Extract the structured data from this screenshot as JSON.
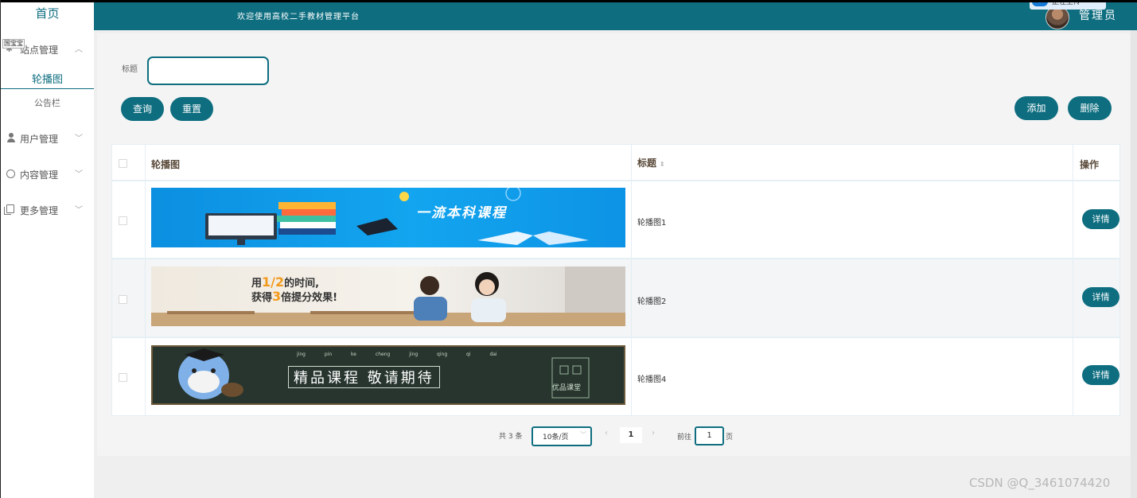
{
  "header": {
    "title": "欢迎使用高校二手教材管理平台",
    "admin": "管理员",
    "upload_badge": "正在上传"
  },
  "sidebar": {
    "home": "首页",
    "overlay_tag": "国宝宝",
    "groups": [
      {
        "label": "站点管理",
        "icon": "site-icon",
        "expanded": true
      },
      {
        "label": "用户管理",
        "icon": "user-icon"
      },
      {
        "label": "内容管理",
        "icon": "chat-icon"
      },
      {
        "label": "更多管理",
        "icon": "copy-icon"
      }
    ],
    "sub_items": [
      {
        "label": "轮播图",
        "active": true
      },
      {
        "label": "公告栏"
      }
    ]
  },
  "filter": {
    "label": "标题",
    "value": "",
    "query": "查询",
    "reset": "重置",
    "add": "添加",
    "delete": "删除"
  },
  "table": {
    "headers": [
      "轮播图",
      "标题",
      "操作"
    ],
    "rows": [
      {
        "title": "轮播图1",
        "action": "详情",
        "banner_text": "一流本科课程"
      },
      {
        "title": "轮播图2",
        "action": "详情",
        "banner_line1_a": "用",
        "banner_line1_b": "1/2",
        "banner_line1_c": "的时间,",
        "banner_line2_a": "获得",
        "banner_line2_b": "3",
        "banner_line2_c": "倍提分效果!"
      },
      {
        "title": "轮播图4",
        "action": "详情",
        "banner_text": "精品课程 敬请期待",
        "banner_pinyin": "jing pin ke cheng jing qing qi dai",
        "banner_sign": "优品课堂"
      }
    ]
  },
  "pagination": {
    "total": "共 3 条",
    "page_size": "10条/页",
    "current": "1",
    "goto_label": "前往",
    "goto_value": "1",
    "goto_unit": "页"
  },
  "watermark": "CSDN @Q_3461074420",
  "colors": {
    "primary": "#0e6e80",
    "content_bg": "#efefef"
  }
}
